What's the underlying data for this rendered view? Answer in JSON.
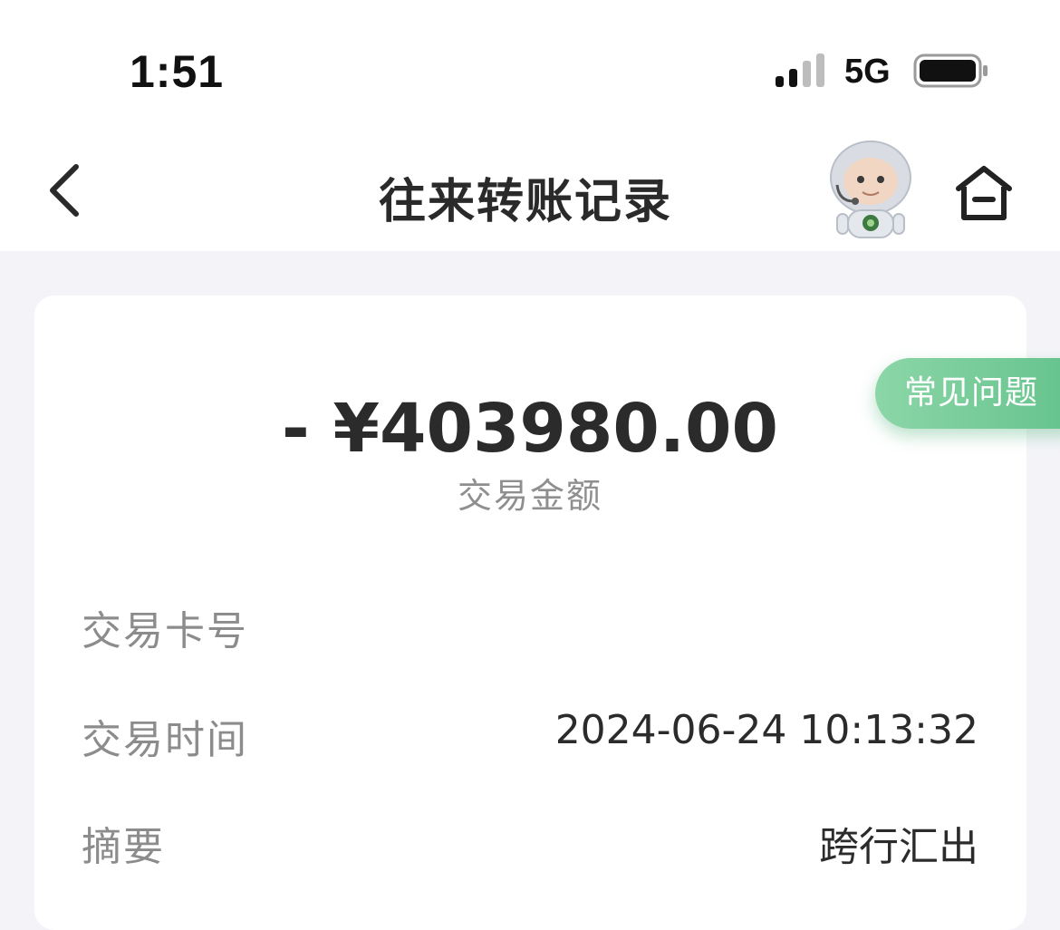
{
  "status_bar": {
    "time": "1:51",
    "network": "5G",
    "icons": [
      "signal-icon",
      "battery-icon"
    ]
  },
  "nav": {
    "title": "往来转账记录",
    "icons": [
      "back-chevron-icon",
      "robot-assistant-icon",
      "home-icon"
    ]
  },
  "faq": {
    "label": "常见问题"
  },
  "transaction": {
    "amount": "- ¥403980.00",
    "amount_label": "交易金额",
    "rows": [
      {
        "label": "交易卡号",
        "value": ""
      },
      {
        "label": "交易时间",
        "value": "2024-06-24 10:13:32"
      },
      {
        "label": "摘要",
        "value": "跨行汇出"
      }
    ]
  },
  "colors": {
    "accent_green": "#65c38d",
    "background": "#f4f4f8",
    "label_gray": "#8c8c8c",
    "text_dark": "#2b2b2b"
  }
}
